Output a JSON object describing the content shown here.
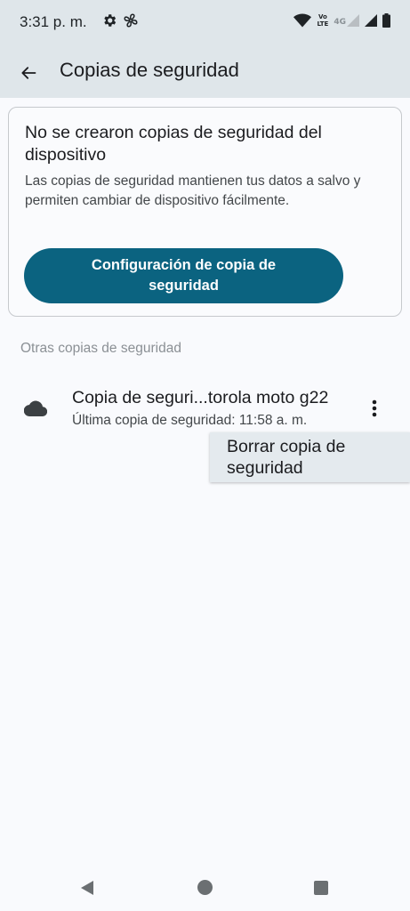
{
  "status_bar": {
    "time": "3:31 p. m.",
    "icons": [
      "settings-gear-icon",
      "fan-icon",
      "wifi-icon",
      "volte-icon",
      "signal-4g-icon",
      "signal-icon",
      "battery-icon"
    ],
    "volte_top": "Vo",
    "volte_bottom": "LTE",
    "network_label": "4G"
  },
  "header": {
    "title": "Copias de seguridad",
    "back_icon": "arrow-back-icon"
  },
  "status_card": {
    "title": "No se crearon copias de seguridad del dispositivo",
    "description": "Las copias de seguridad mantienen tus datos a salvo y permiten cambiar de dispositivo fácilmente.",
    "button_label": "Configuración de copia de seguridad",
    "button_color": "#0b6380"
  },
  "other_backups": {
    "section_label": "Otras copias de seguridad",
    "items": [
      {
        "icon": "cloud-icon",
        "title": "Copia de seguri...torola moto g22",
        "subtitle": "Última copia de seguridad: 11:58 a. m."
      }
    ]
  },
  "overflow_menu": {
    "items": [
      {
        "label": "Borrar copia de seguridad"
      }
    ]
  },
  "nav_bar": {
    "icons": [
      "nav-back-icon",
      "nav-home-icon",
      "nav-recents-icon"
    ]
  }
}
